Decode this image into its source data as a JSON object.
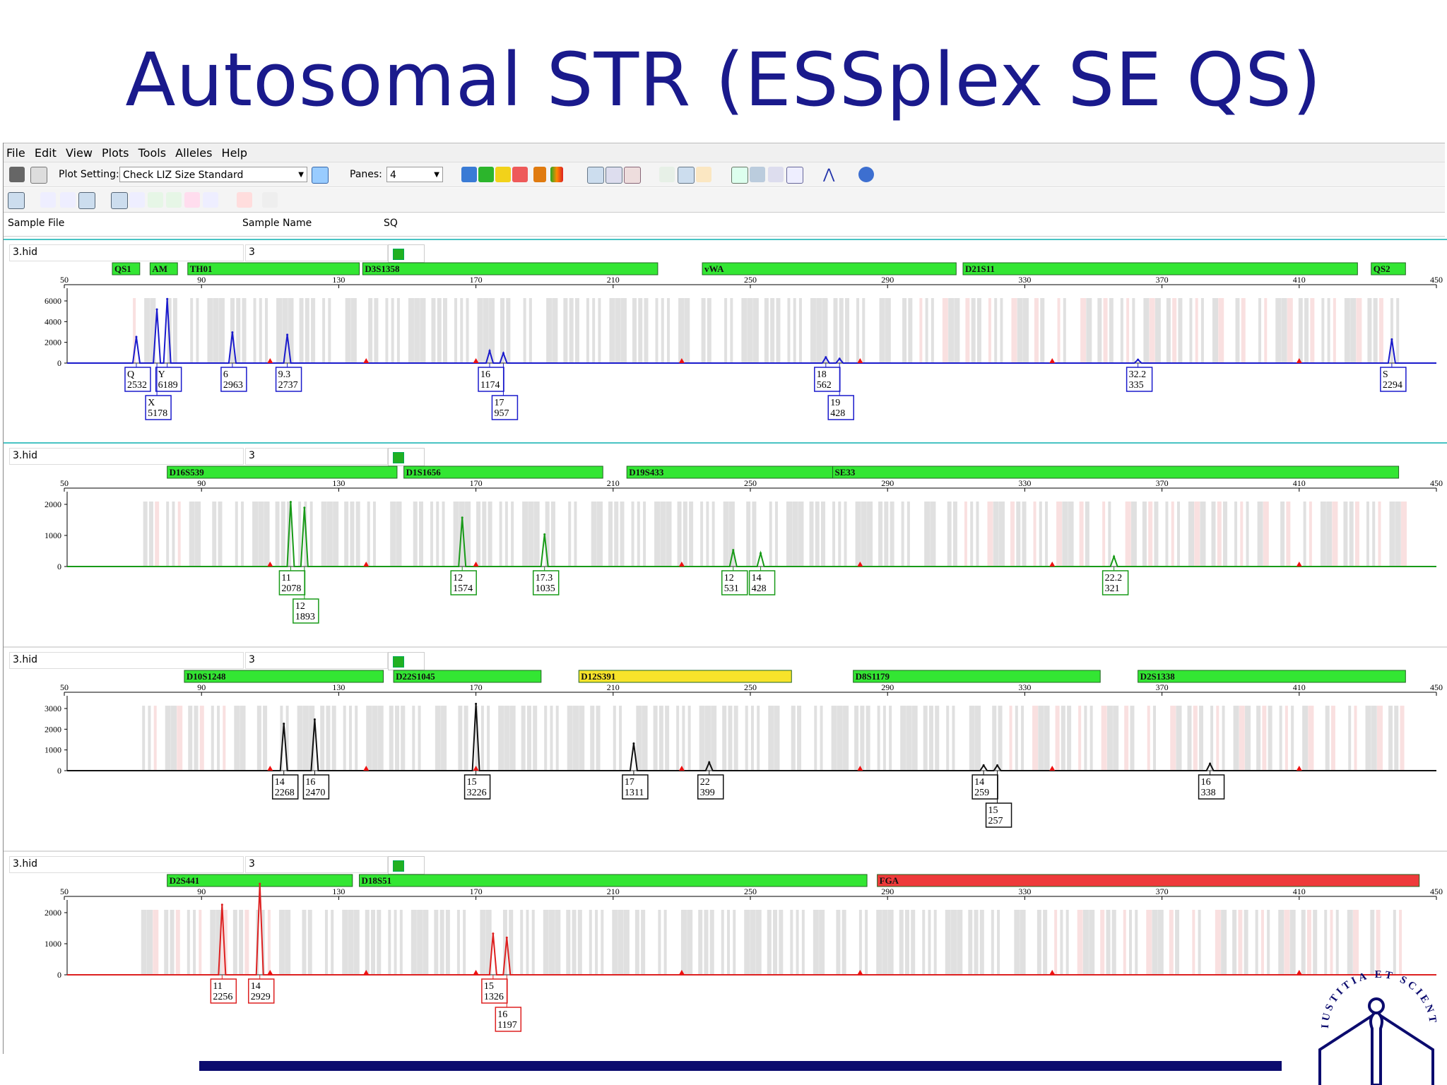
{
  "slide": {
    "title": "Autosomal STR (ESSplex SE QS)"
  },
  "menu": [
    "File",
    "Edit",
    "View",
    "Plots",
    "Tools",
    "Alleles",
    "Help"
  ],
  "toolbar": {
    "plot_setting_label": "Plot Setting:",
    "plot_setting_value": "Check LIZ Size Standard",
    "panes_label": "Panes:",
    "panes_value": "4"
  },
  "columns": {
    "sample_file": "Sample File",
    "sample_name": "Sample Name",
    "sq": "SQ"
  },
  "logo": {
    "text": "IUSTITIA ET SCIENTIA"
  },
  "chart_data": {
    "type": "line",
    "x_axis": {
      "range": [
        50,
        450
      ],
      "ticks": [
        50,
        90,
        130,
        170,
        210,
        250,
        290,
        330,
        370,
        410,
        450
      ],
      "unit": "bp"
    },
    "panels": [
      {
        "sample_file": "3.hid",
        "sample_name": "3",
        "dye_color": "#1a1acc",
        "ymax": 6000,
        "yticks": [
          0,
          2000,
          4000,
          6000
        ],
        "markers": [
          {
            "name": "QS1",
            "start": 64,
            "end": 72,
            "color": "green"
          },
          {
            "name": "AM",
            "start": 75,
            "end": 83,
            "color": "green"
          },
          {
            "name": "TH01",
            "start": 86,
            "end": 136,
            "color": "green"
          },
          {
            "name": "D3S1358",
            "start": 137,
            "end": 223,
            "color": "green"
          },
          {
            "name": "vWA",
            "start": 236,
            "end": 310,
            "color": "green"
          },
          {
            "name": "D21S11",
            "start": 312,
            "end": 427,
            "color": "green"
          },
          {
            "name": "QS2",
            "start": 431,
            "end": 441,
            "color": "green"
          }
        ],
        "peaks": [
          [
            71,
            2532
          ],
          [
            77,
            5178
          ],
          [
            80,
            6189
          ],
          [
            99,
            2963
          ],
          [
            115,
            2737
          ],
          [
            174,
            1174
          ],
          [
            178,
            957
          ],
          [
            272,
            562
          ],
          [
            276,
            428
          ],
          [
            363,
            335
          ],
          [
            437,
            2294
          ]
        ],
        "labels": [
          {
            "x": 71,
            "allele": "Q",
            "size": "2532",
            "row": 0
          },
          {
            "x": 80,
            "allele": "Y",
            "size": "6189",
            "row": 0
          },
          {
            "x": 77,
            "allele": "X",
            "size": "5178",
            "row": 1
          },
          {
            "x": 99,
            "allele": "6",
            "size": "2963",
            "row": 0
          },
          {
            "x": 115,
            "allele": "9.3",
            "size": "2737",
            "row": 0
          },
          {
            "x": 174,
            "allele": "16",
            "size": "1174",
            "row": 0
          },
          {
            "x": 178,
            "allele": "17",
            "size": "957",
            "row": 1
          },
          {
            "x": 272,
            "allele": "18",
            "size": "562",
            "row": 0
          },
          {
            "x": 276,
            "allele": "19",
            "size": "428",
            "row": 1
          },
          {
            "x": 363,
            "allele": "32.2",
            "size": "335",
            "row": 0
          },
          {
            "x": 437,
            "allele": "S",
            "size": "2294",
            "row": 0
          }
        ]
      },
      {
        "sample_file": "3.hid",
        "sample_name": "3",
        "dye_color": "#189a18",
        "ymax": 2000,
        "yticks": [
          0,
          1000,
          2000
        ],
        "markers": [
          {
            "name": "D16S539",
            "start": 80,
            "end": 147,
            "color": "green"
          },
          {
            "name": "D1S1656",
            "start": 149,
            "end": 207,
            "color": "green"
          },
          {
            "name": "D19S433",
            "start": 214,
            "end": 274,
            "color": "green"
          },
          {
            "name": "SE33",
            "start": 274,
            "end": 439,
            "color": "green"
          }
        ],
        "peaks": [
          [
            116,
            2078
          ],
          [
            120,
            1893
          ],
          [
            166,
            1574
          ],
          [
            190,
            1035
          ],
          [
            245,
            531
          ],
          [
            253,
            428
          ],
          [
            356,
            321
          ]
        ],
        "labels": [
          {
            "x": 116,
            "allele": "11",
            "size": "2078",
            "row": 0
          },
          {
            "x": 120,
            "allele": "12",
            "size": "1893",
            "row": 1
          },
          {
            "x": 166,
            "allele": "12",
            "size": "1574",
            "row": 0
          },
          {
            "x": 190,
            "allele": "17.3",
            "size": "1035",
            "row": 0
          },
          {
            "x": 245,
            "allele": "12",
            "size": "531",
            "row": 0
          },
          {
            "x": 253,
            "allele": "14",
            "size": "428",
            "row": 0
          },
          {
            "x": 356,
            "allele": "22.2",
            "size": "321",
            "row": 0
          }
        ]
      },
      {
        "sample_file": "3.hid",
        "sample_name": "3",
        "dye_color": "#111111",
        "ymax": 3000,
        "yticks": [
          0,
          1000,
          2000,
          3000
        ],
        "markers": [
          {
            "name": "D10S1248",
            "start": 85,
            "end": 143,
            "color": "green"
          },
          {
            "name": "D22S1045",
            "start": 146,
            "end": 189,
            "color": "green"
          },
          {
            "name": "D12S391",
            "start": 200,
            "end": 262,
            "color": "yellow"
          },
          {
            "name": "D8S1179",
            "start": 280,
            "end": 352,
            "color": "green"
          },
          {
            "name": "D2S1338",
            "start": 363,
            "end": 441,
            "color": "green"
          }
        ],
        "peaks": [
          [
            114,
            2268
          ],
          [
            123,
            2470
          ],
          [
            170,
            3226
          ],
          [
            216,
            1311
          ],
          [
            238,
            399
          ],
          [
            318,
            259
          ],
          [
            322,
            257
          ],
          [
            384,
            338
          ]
        ],
        "labels": [
          {
            "x": 114,
            "allele": "14",
            "size": "2268",
            "row": 0
          },
          {
            "x": 123,
            "allele": "16",
            "size": "2470",
            "row": 0
          },
          {
            "x": 170,
            "allele": "15",
            "size": "3226",
            "row": 0
          },
          {
            "x": 216,
            "allele": "17",
            "size": "1311",
            "row": 0
          },
          {
            "x": 238,
            "allele": "22",
            "size": "399",
            "row": 0
          },
          {
            "x": 318,
            "allele": "14",
            "size": "259",
            "row": 0
          },
          {
            "x": 322,
            "allele": "15",
            "size": "257",
            "row": 1
          },
          {
            "x": 384,
            "allele": "16",
            "size": "338",
            "row": 0
          }
        ]
      },
      {
        "sample_file": "3.hid",
        "sample_name": "3",
        "dye_color": "#dd2020",
        "ymax": 2000,
        "yticks": [
          0,
          1000,
          2000
        ],
        "markers": [
          {
            "name": "D2S441",
            "start": 80,
            "end": 134,
            "color": "green"
          },
          {
            "name": "D18S51",
            "start": 136,
            "end": 284,
            "color": "green"
          },
          {
            "name": "FGA",
            "start": 287,
            "end": 445,
            "color": "red"
          }
        ],
        "peaks": [
          [
            96,
            2256
          ],
          [
            107,
            2929
          ],
          [
            175,
            1326
          ],
          [
            179,
            1197
          ]
        ],
        "labels": [
          {
            "x": 96,
            "allele": "11",
            "size": "2256",
            "row": 0
          },
          {
            "x": 107,
            "allele": "14",
            "size": "2929",
            "row": 0
          },
          {
            "x": 175,
            "allele": "15",
            "size": "1326",
            "row": 0
          },
          {
            "x": 179,
            "allele": "16",
            "size": "1197",
            "row": 1
          }
        ]
      }
    ]
  }
}
